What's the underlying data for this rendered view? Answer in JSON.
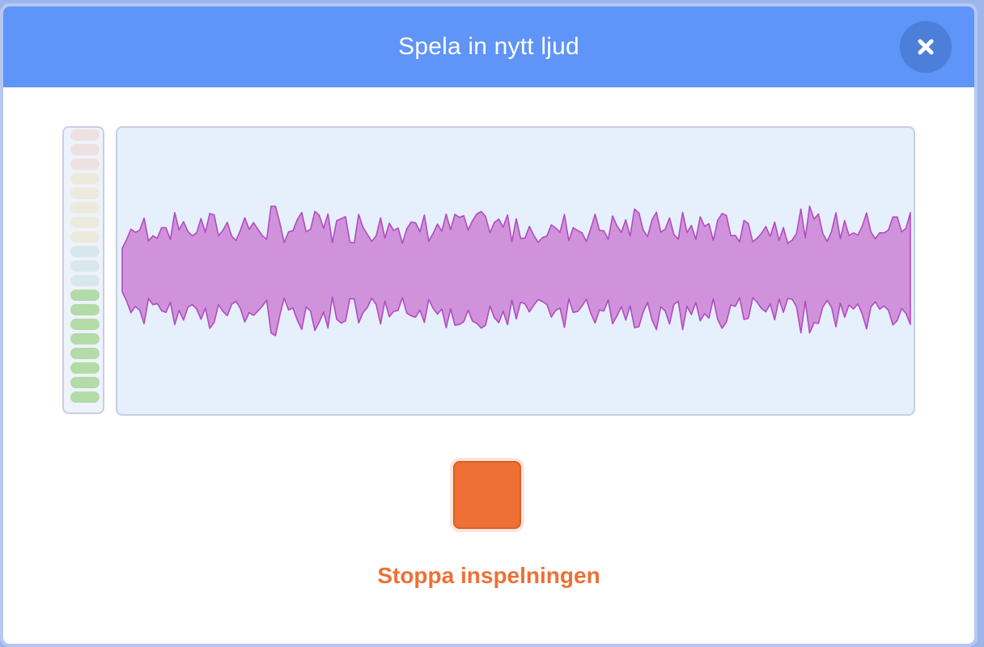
{
  "modal": {
    "title": "Spela in nytt ljud",
    "close_icon": "close-icon",
    "header_color": "#5f94f8",
    "close_bg_color": "#4c7fd9"
  },
  "level_meter": {
    "segments_total": 19,
    "lit_segments": 8,
    "colors": {
      "lit": "#b2dba7",
      "unlit_low": "#d8e8ea",
      "unlit_mid": "#ebeadc",
      "unlit_high": "#eee1e1"
    }
  },
  "waveform": {
    "fill_color": "#d192dc",
    "stroke_color": "#b04cc0",
    "background_color": "#e6effc"
  },
  "recording": {
    "stop_icon": "stop-square-icon",
    "stop_label": "Stoppa inspelningen",
    "accent_color": "#ee7035"
  }
}
